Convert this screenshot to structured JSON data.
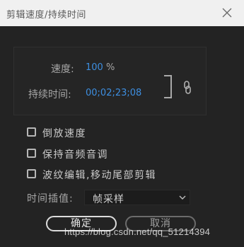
{
  "window": {
    "title": "剪辑速度/持续时间"
  },
  "speed": {
    "label": "速度:",
    "value": "100",
    "unit": "%"
  },
  "duration": {
    "label": "持续时间:",
    "value": "00;02;23;08"
  },
  "options": {
    "reverse_speed": {
      "label": "倒放速度",
      "checked": false
    },
    "maintain_audio_pitch": {
      "label": "保持音频音调",
      "checked": false
    },
    "ripple_edit": {
      "label": "波纹编辑,移动尾部剪辑",
      "checked": false
    }
  },
  "time_interpolation": {
    "label": "时间插值:",
    "selected": "帧采样"
  },
  "buttons": {
    "ok": "确定",
    "cancel": "取消"
  },
  "watermark": "https://blog.csdn.net/qq_51214394",
  "icons": {
    "close": "close-icon",
    "link": "link-icon",
    "dropdown": "chevron-down-icon"
  },
  "colors": {
    "accent_value": "#3d8ee0",
    "dialog_bg": "#232323",
    "titlebar_bg": "#f0f0f0"
  }
}
